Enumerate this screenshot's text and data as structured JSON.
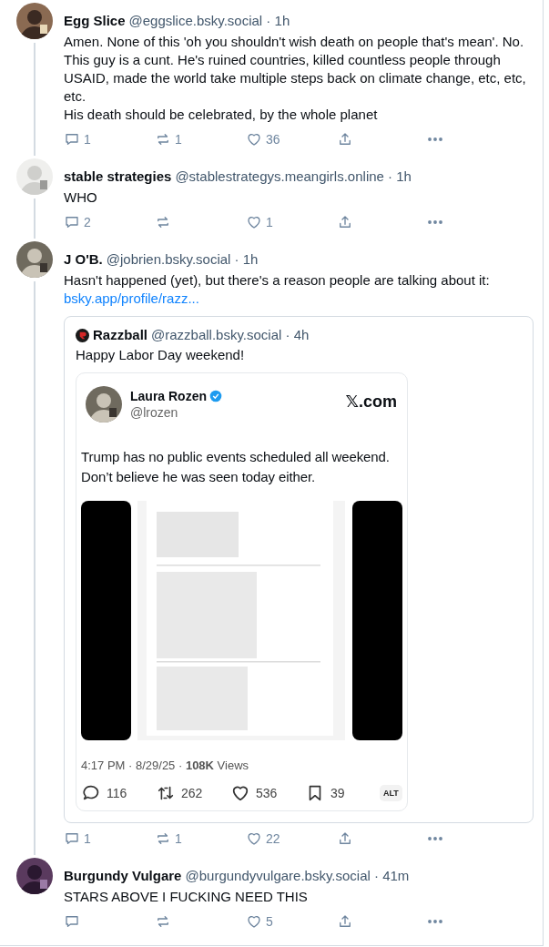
{
  "posts": [
    {
      "author": "Egg Slice",
      "byline": "@eggslice.bsky.social · 1h",
      "text": "Amen. None of this 'oh you shouldn't wish death on people that's mean'. No. This guy is a cunt. He's ruined countries, killed countless people through USAID, made the world take multiple steps back on climate change, etc, etc, etc.\nHis death should be celebrated, by the whole planet",
      "thread_continues": true,
      "replies": "1",
      "reposts": "1",
      "likes": "36"
    },
    {
      "author": "stable strategies",
      "byline": "@stablestrategys.meangirls.online · 1h",
      "text": "WHO",
      "thread_continues": true,
      "replies": "2",
      "likes": "1"
    },
    {
      "author": "J O'B.",
      "byline": "@jobrien.bsky.social · 1h",
      "text": "Hasn't happened (yet), but there's a reason people are talking about it:",
      "link": "bsky.app/profile/razz...",
      "thread_continues": true,
      "quote": {
        "author": "Razzball",
        "byline": "@razzball.bsky.social · 4h",
        "text": "Happy Labor Day weekend!",
        "tweet": {
          "name": "Laura Rozen",
          "verified": true,
          "handle": "@lrozen",
          "site": "𝕏.com",
          "text": "Trump has no public events scheduled all weekend. Don’t believe he was seen today either.",
          "meta": "4:17 PM · 8/29/25 · **108K** Views",
          "replies": "116",
          "reposts": "262",
          "likes": "536",
          "bookmarks": "39",
          "alt": "ALT"
        }
      },
      "replies": "1",
      "reposts": "1",
      "likes": "22"
    },
    {
      "author": "Burgundy Vulgare",
      "byline": "@burgundyvulgare.bsky.social · 41m",
      "text": "STARS ABOVE I FUCKING NEED THIS",
      "thread_continues": false,
      "likes": "5"
    }
  ]
}
